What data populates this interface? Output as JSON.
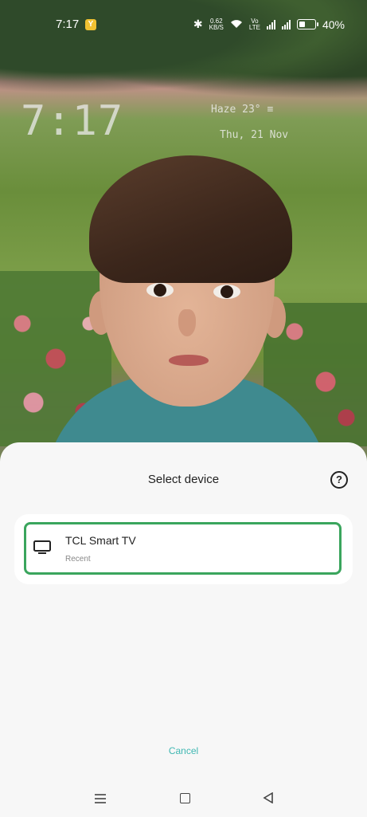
{
  "status_bar": {
    "time": "7:17",
    "badge_icon": "notification-app-icon",
    "net_speed_value": "0.62",
    "net_speed_unit": "KB/S",
    "volte_top": "Vo",
    "volte_bottom": "LTE",
    "battery_percent": "40%"
  },
  "lock_screen": {
    "clock": "7:17",
    "weather": "Haze 23°",
    "date": "Thu, 21 Nov"
  },
  "dialog": {
    "title": "Select device",
    "help_icon": "help-circle-icon",
    "devices": [
      {
        "name": "TCL Smart TV",
        "subtitle": "Recent",
        "icon": "tv-icon",
        "selected": true
      }
    ],
    "cancel_label": "Cancel"
  },
  "nav_bar": {
    "icons": [
      "menu-icon",
      "home-icon",
      "back-icon"
    ]
  },
  "colors": {
    "accent_green": "#3aa55d",
    "cancel_teal": "#3fb7b2",
    "sheet_bg": "#f7f7f7"
  }
}
